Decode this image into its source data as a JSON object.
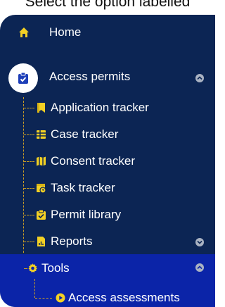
{
  "instruction": "Select the option labelled",
  "nav": {
    "home": {
      "label": "Home",
      "icon": "home-icon"
    },
    "access_permits": {
      "label": "Access permits",
      "icon": "clipboard-check-icon"
    },
    "items": [
      {
        "label": "Application tracker",
        "icon": "bookmark-icon"
      },
      {
        "label": "Case tracker",
        "icon": "grid-icon"
      },
      {
        "label": "Consent tracker",
        "icon": "map-icon"
      },
      {
        "label": "Task tracker",
        "icon": "calendar-clock-icon"
      },
      {
        "label": "Permit library",
        "icon": "clipboard-check-icon"
      },
      {
        "label": "Reports",
        "icon": "report-icon"
      }
    ],
    "tools": {
      "label": "Tools",
      "icon": "gear-icon"
    },
    "tools_children": [
      {
        "label": "Access assessments",
        "icon": "play-circle-icon"
      }
    ],
    "colors": {
      "background": "#0c2554",
      "selected_band": "#0b24a8",
      "icon_accent": "#f2d024",
      "tree_line": "#c89c25"
    }
  }
}
